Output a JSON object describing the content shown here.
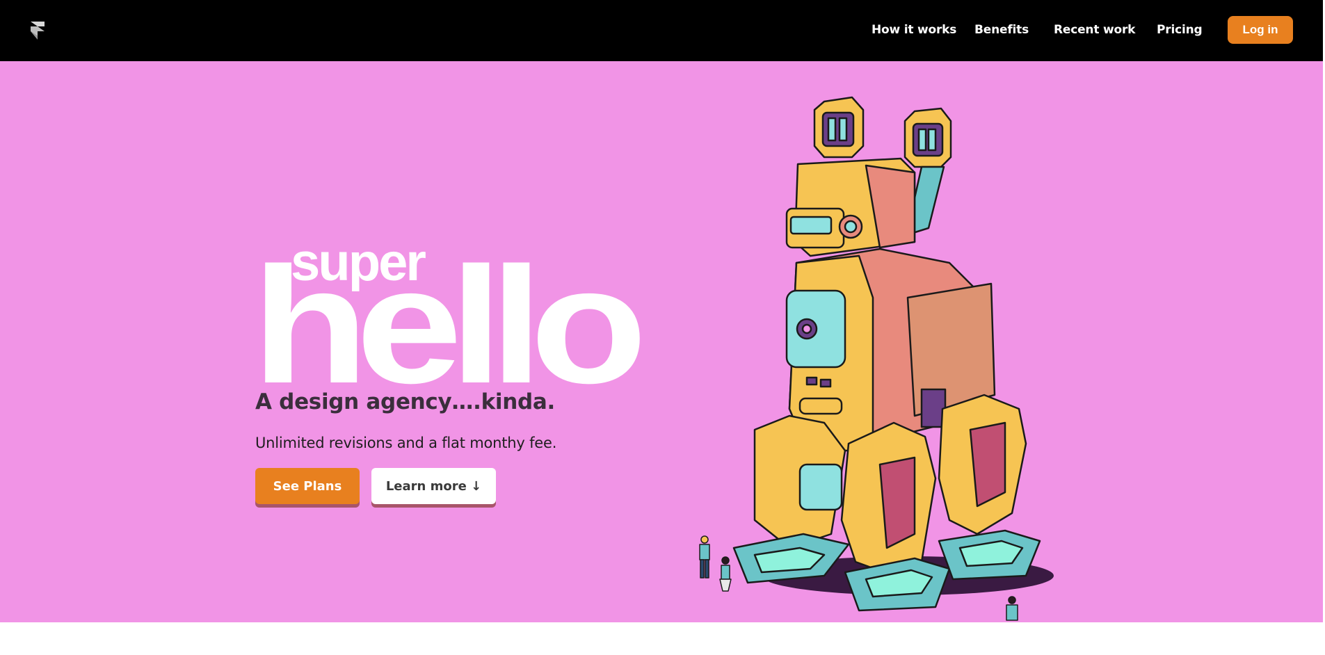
{
  "nav": {
    "links": [
      "How it works",
      "Benefits",
      "Recent work",
      "Pricing"
    ],
    "login_label": "Log in"
  },
  "hero": {
    "brand_top": "super",
    "brand_main": "hello",
    "tagline": "A design agency….kinda.",
    "subtext": "Unlimited revisions and a flat monthy fee.",
    "primary_button": "See Plans",
    "secondary_button": "Learn more ↓"
  },
  "colors": {
    "nav_bg": "#000000",
    "hero_bg": "#f194e6",
    "accent": "#e8801f",
    "button_shadow": "#a8556a"
  },
  "icons": {
    "logo": "framer-logo-icon",
    "illustration": "robot-illustration"
  }
}
